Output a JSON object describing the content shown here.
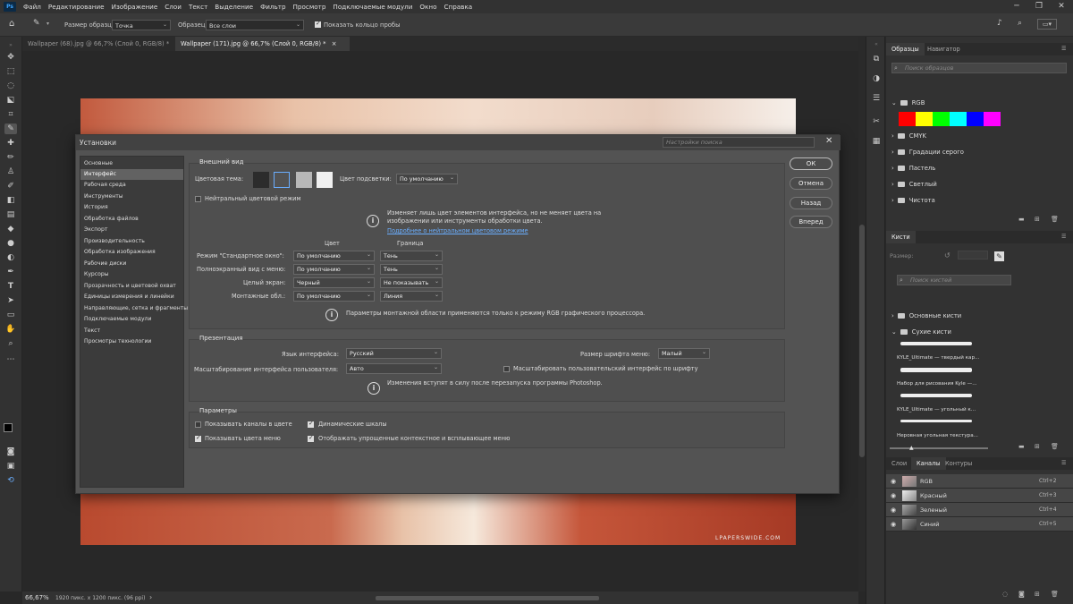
{
  "menubar": {
    "logo": "Ps",
    "items": [
      "Файл",
      "Редактирование",
      "Изображение",
      "Слои",
      "Текст",
      "Выделение",
      "Фильтр",
      "Просмотр",
      "Подключаемые модули",
      "Окно",
      "Справка"
    ]
  },
  "optionsbar": {
    "sample_size_label": "Размер образца:",
    "sample_size_value": "Точка",
    "sample_label": "Образец:",
    "sample_value": "Все слои",
    "show_ring_label": "Показать кольцо пробы"
  },
  "tabs": [
    {
      "label": "Wallpaper (68).jpg @ 66,7% (Слой 0, RGB/8) *",
      "close": "×"
    },
    {
      "label": "Wallpaper (171).jpg @ 66,7% (Слой 0, RGB/8) *",
      "close": "×"
    }
  ],
  "status": {
    "zoom": "66,67%",
    "info": "1920 пикс. x 1200 пикс. (96 ppi)",
    "arrow": "›"
  },
  "watermark": "LPAPERSWIDE.COM",
  "dialog": {
    "title": "Установки",
    "search_placeholder": "Настройки поиска",
    "close": "✕",
    "categories": [
      "Основные",
      "Интерфейс",
      "Рабочая среда",
      "Инструменты",
      "История",
      "Обработка файлов",
      "Экспорт",
      "Производительность",
      "Обработка изображения",
      "Рабочие диски",
      "Курсоры",
      "Прозрачность и цветовой охват",
      "Единицы измерения и линейки",
      "Направляющие, сетка и фрагменты",
      "Подключаемые модули",
      "Текст",
      "Просмотры технологии"
    ],
    "selected_category": "Интерфейс",
    "appearance": {
      "title": "Внешний вид",
      "color_theme_label": "Цветовая тема:",
      "highlight_label": "Цвет подсветки:",
      "highlight_value": "По умолчанию",
      "neutral_label": "Нейтральный цветовой режим",
      "info_text_1": "Изменяет лишь цвет элементов интерфейса, но не меняет цвета на",
      "info_text_2": "изображении или инструменты обработки цвета.",
      "info_link": "Подробнее о нейтральном цветовом режиме",
      "col_color": "Цвет",
      "col_border": "Граница",
      "rows": [
        {
          "label": "Режим \"Стандартное окно\":",
          "color": "По умолчанию",
          "border": "Тень"
        },
        {
          "label": "Полноэкранный вид с меню:",
          "color": "По умолчанию",
          "border": "Тень"
        },
        {
          "label": "Целый экран:",
          "color": "Черный",
          "border": "Не показывать"
        },
        {
          "label": "Монтажные обл.:",
          "color": "По умолчанию",
          "border": "Линия"
        }
      ],
      "artboard_note": "Параметры монтажной области применяются только к режиму RGB графического процессора."
    },
    "presentation": {
      "title": "Презентация",
      "ui_language_label": "Язык интерфейса:",
      "ui_language_value": "Русский",
      "font_size_label": "Размер шрифта меню:",
      "font_size_value": "Малый",
      "ui_scaling_label": "Масштабирование интерфейса пользователя:",
      "ui_scaling_value": "Авто",
      "scale_to_font_label": "Масштабировать пользовательский интерфейс по шрифту",
      "restart_note": "Изменения вступят в силу после перезапуска программы Photoshop."
    },
    "options": {
      "title": "Параметры",
      "show_channels_color": "Показывать каналы в цвете",
      "dynamic_sliders": "Динамические шкалы",
      "show_menu_colors": "Показывать цвета меню",
      "simplified_context": "Отображать упрощенные контекстное и всплывающее меню"
    },
    "buttons": {
      "ok": "ОК",
      "cancel": "Отмена",
      "prev": "Назад",
      "next": "Вперед"
    }
  },
  "swatches_panel": {
    "tabs": [
      "Образцы",
      "Навигатор"
    ],
    "search_placeholder": "Поиск образцов",
    "groups": [
      "RGB",
      "CMYK",
      "Градации серого",
      "Пастель",
      "Светлый",
      "Чистота"
    ],
    "rgb_colors": [
      "#ff0000",
      "#ffff00",
      "#00ff00",
      "#00ffff",
      "#0000ff",
      "#ff00ff"
    ]
  },
  "brushes_panel": {
    "tab": "Кисти",
    "size_label": "Размер:",
    "search_placeholder": "Поиск кистей",
    "groups": [
      "Основные кисти",
      "Сухие кисти"
    ],
    "brushes": [
      "KYLE_Ultimate — твердый кар...",
      "Набор для рисования Kyle —...",
      "KYLE_Ultimate — угольный к...",
      "Неровная угольная текстура..."
    ]
  },
  "channels_panel": {
    "tabs": [
      "Слои",
      "Каналы",
      "Контуры"
    ],
    "channels": [
      {
        "name": "RGB",
        "shortcut": "Ctrl+2"
      },
      {
        "name": "Красный",
        "shortcut": "Ctrl+3"
      },
      {
        "name": "Зеленый",
        "shortcut": "Ctrl+4"
      },
      {
        "name": "Синий",
        "shortcut": "Ctrl+5"
      }
    ]
  }
}
